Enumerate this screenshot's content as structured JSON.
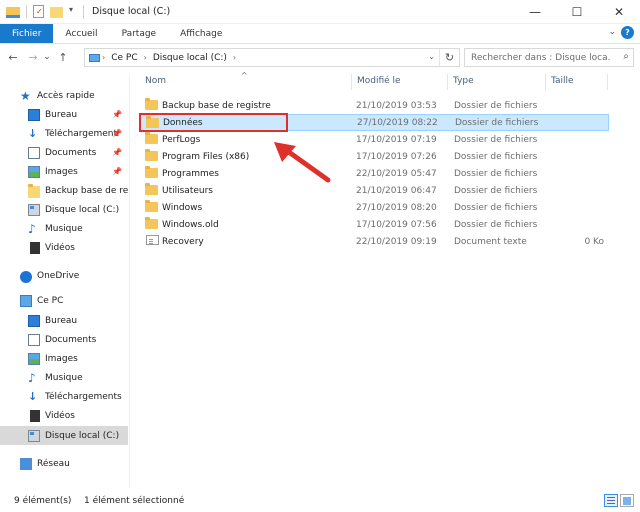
{
  "window": {
    "title": "Disque local (C:)",
    "controls": {
      "minimize": "—",
      "maximize": "☐",
      "close": "✕"
    }
  },
  "ribbon": {
    "tabs": [
      "Fichier",
      "Accueil",
      "Partage",
      "Affichage"
    ],
    "expand_glyph": "⌄",
    "help_glyph": "?"
  },
  "nav": {
    "back_glyph": "←",
    "forward_glyph": "→",
    "recent_glyph": "⌄",
    "up_glyph": "↑",
    "breadcrumb": [
      "Ce PC",
      "Disque local (C:)"
    ],
    "search_placeholder": "Rechercher dans : Disque loca..."
  },
  "sidebar": {
    "quick_access": "Accès rapide",
    "quick_items": [
      {
        "label": "Bureau",
        "icon": "desktop-icon",
        "pinned": true
      },
      {
        "label": "Téléchargements",
        "icon": "download-icon",
        "pinned": true
      },
      {
        "label": "Documents",
        "icon": "documents-icon",
        "pinned": true
      },
      {
        "label": "Images",
        "icon": "pictures-icon",
        "pinned": true
      },
      {
        "label": "Backup base de reg",
        "icon": "folder-icon",
        "pinned": false
      },
      {
        "label": "Disque local (C:)",
        "icon": "drive-icon",
        "pinned": false
      },
      {
        "label": "Musique",
        "icon": "music-icon",
        "pinned": false
      },
      {
        "label": "Vidéos",
        "icon": "videos-icon",
        "pinned": false
      }
    ],
    "onedrive": "OneDrive",
    "this_pc": "Ce PC",
    "pc_items": [
      {
        "label": "Bureau",
        "icon": "desktop-icon"
      },
      {
        "label": "Documents",
        "icon": "documents-icon"
      },
      {
        "label": "Images",
        "icon": "pictures-icon"
      },
      {
        "label": "Musique",
        "icon": "music-icon"
      },
      {
        "label": "Téléchargements",
        "icon": "download-icon"
      },
      {
        "label": "Vidéos",
        "icon": "videos-icon"
      },
      {
        "label": "Disque local (C:)",
        "icon": "drive-icon",
        "selected": true
      }
    ],
    "network": "Réseau"
  },
  "columns": {
    "name": "Nom",
    "date": "Modifié le",
    "type": "Type",
    "size": "Taille"
  },
  "files": [
    {
      "name": "Backup base de registre",
      "date": "21/10/2019 03:53",
      "type": "Dossier de fichiers",
      "size": "",
      "icon": "folder-icon"
    },
    {
      "name": "Données",
      "date": "27/10/2019 08:22",
      "type": "Dossier de fichiers",
      "size": "",
      "icon": "folder-icon",
      "selected": true
    },
    {
      "name": "PerfLogs",
      "date": "17/10/2019 07:19",
      "type": "Dossier de fichiers",
      "size": "",
      "icon": "folder-icon"
    },
    {
      "name": "Program Files (x86)",
      "date": "17/10/2019 07:26",
      "type": "Dossier de fichiers",
      "size": "",
      "icon": "folder-icon"
    },
    {
      "name": "Programmes",
      "date": "22/10/2019 05:47",
      "type": "Dossier de fichiers",
      "size": "",
      "icon": "folder-icon"
    },
    {
      "name": "Utilisateurs",
      "date": "21/10/2019 06:47",
      "type": "Dossier de fichiers",
      "size": "",
      "icon": "folder-icon"
    },
    {
      "name": "Windows",
      "date": "27/10/2019 08:20",
      "type": "Dossier de fichiers",
      "size": "",
      "icon": "folder-icon"
    },
    {
      "name": "Windows.old",
      "date": "17/10/2019 07:56",
      "type": "Dossier de fichiers",
      "size": "",
      "icon": "folder-icon"
    },
    {
      "name": "Recovery",
      "date": "22/10/2019 09:19",
      "type": "Document texte",
      "size": "0 Ko",
      "icon": "text-file-icon"
    }
  ],
  "status": {
    "count": "9 élément(s)",
    "selection": "1 élément sélectionné"
  },
  "colors": {
    "file_tab": "#1979ca",
    "selection_bg": "#cce8ff",
    "annotation_red": "#e0302c"
  }
}
